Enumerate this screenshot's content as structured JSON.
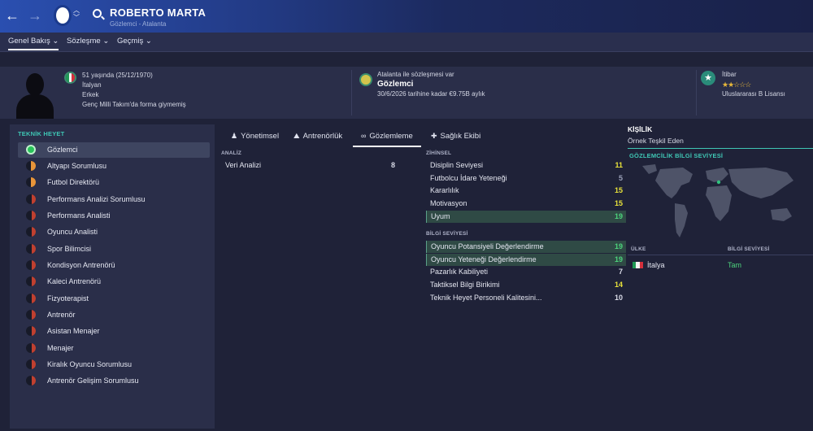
{
  "header": {
    "name": "ROBERTO MARTA",
    "subtitle": "Gözlemci - Atalanta"
  },
  "subnav": {
    "tabs": [
      {
        "label": "Genel Bakış ⌄"
      },
      {
        "label": "Sözleşme ⌄"
      },
      {
        "label": "Geçmiş ⌄"
      }
    ]
  },
  "profile": {
    "age_line": "51 yaşında (25/12/1970)",
    "nationality": "İtalyan",
    "gender": "Erkek",
    "youth_caps": "Genç Milli Takım'da forma giymemiş"
  },
  "contract": {
    "club_line": "Atalanta ile sözleşmesi var",
    "role": "Gözlemci",
    "terms": "30/6/2026 tarihine kadar €9.75B aylık"
  },
  "reputation": {
    "label": "İtibar",
    "stars": "★★☆☆☆",
    "licence": "Uluslararası B Lisansı"
  },
  "staff": {
    "title": "TEKNİK HEYET",
    "roles": [
      {
        "label": "Gözlemci"
      },
      {
        "label": "Altyapı Sorumlusu"
      },
      {
        "label": "Futbol Direktörü"
      },
      {
        "label": "Performans Analizi Sorumlusu"
      },
      {
        "label": "Performans Analisti"
      },
      {
        "label": "Oyuncu Analisti"
      },
      {
        "label": "Spor Bilimcisi"
      },
      {
        "label": "Kondisyon Antrenörü"
      },
      {
        "label": "Kaleci Antrenörü"
      },
      {
        "label": "Fizyoterapist"
      },
      {
        "label": "Antrenör"
      },
      {
        "label": "Asistan Menajer"
      },
      {
        "label": "Menajer"
      },
      {
        "label": "Kiralık Oyuncu Sorumlusu"
      },
      {
        "label": "Antrenör Gelişim Sorumlusu"
      }
    ]
  },
  "attr_tabs": [
    {
      "label": "Yönetimsel",
      "icon": "person-icon"
    },
    {
      "label": "Antrenörlük",
      "icon": "cones-icon"
    },
    {
      "label": "Gözlemleme",
      "icon": "binoculars-icon"
    },
    {
      "label": "Sağlık Ekibi",
      "icon": "medical-icon"
    }
  ],
  "analysis": {
    "title": "ANALİZ",
    "rows": [
      {
        "label": "Veri Analizi",
        "value": "8"
      }
    ]
  },
  "mental": {
    "title": "ZİHİNSEL",
    "rows": [
      {
        "label": "Disiplin Seviyesi",
        "value": "11"
      },
      {
        "label": "Futbolcu İdare Yeteneği",
        "value": "5"
      },
      {
        "label": "Kararlılık",
        "value": "15"
      },
      {
        "label": "Motivasyon",
        "value": "15"
      },
      {
        "label": "Uyum",
        "value": "19"
      }
    ]
  },
  "knowledge": {
    "title": "BİLGİ SEVİYESİ",
    "rows": [
      {
        "label": "Oyuncu Potansiyeli Değerlendirme",
        "value": "19"
      },
      {
        "label": "Oyuncu Yeteneği Değerlendirme",
        "value": "19"
      },
      {
        "label": "Pazarlık Kabiliyeti",
        "value": "7"
      },
      {
        "label": "Taktiksel Bilgi Birikimi",
        "value": "14"
      },
      {
        "label": "Teknik Heyet Personeli Kalitesini...",
        "value": "10"
      }
    ]
  },
  "personality": {
    "title": "KİŞİLİK",
    "value": "Örnek Teşkil Eden"
  },
  "scouting": {
    "title": "GÖZLEMCİLİK BİLGİ SEVİYESİ",
    "col_country": "ÜLKE",
    "col_level": "BİLGİ SEVİYESİ",
    "rows": [
      {
        "country": "İtalya",
        "level": "Tam"
      }
    ]
  },
  "colors": {
    "accent": "#3fc6b4",
    "good": "#4cd37c",
    "mid": "#e8e23a"
  }
}
